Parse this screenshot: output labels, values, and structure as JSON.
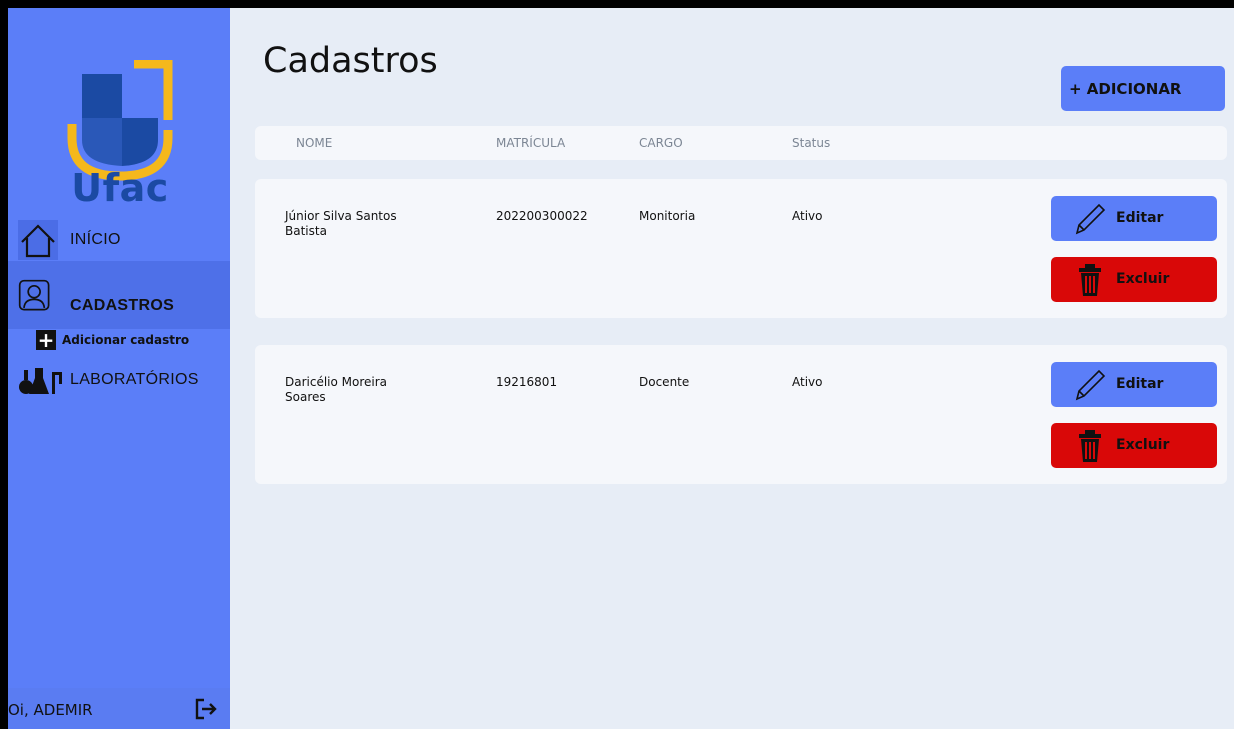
{
  "brand": {
    "name": "Ufac"
  },
  "sidebar": {
    "items": [
      {
        "label": "INÍCIO",
        "icon": "home-icon"
      },
      {
        "label": "CADASTROS",
        "icon": "user-icon",
        "active": true
      },
      {
        "label": "LABORATÓRIOS",
        "icon": "lab-icon"
      }
    ],
    "subitem": {
      "label": "Adicionar cadastro",
      "icon": "plus-icon"
    },
    "user": {
      "greeting": "Oi, ADEMIR",
      "icon": "logout-icon"
    }
  },
  "page": {
    "title": "Cadastros",
    "add_button": "+ ADICIONAR"
  },
  "table": {
    "headers": [
      "NOME",
      "MATRÍCULA",
      "CARGO",
      "Status"
    ],
    "rows": [
      {
        "name": "Júnior Silva Santos Batista",
        "matricula": "202200300022",
        "cargo": "Monitoria",
        "status": "Ativo",
        "edit": "Editar",
        "delete": "Excluir"
      },
      {
        "name": "Daricélio Moreira Soares",
        "matricula": "19216801",
        "cargo": "Docente",
        "status": "Ativo",
        "edit": "Editar",
        "delete": "Excluir"
      }
    ]
  },
  "colors": {
    "sidebar": "#5b7ef8",
    "primary_button": "#5b7ef8",
    "danger_button": "#d90808",
    "logo_dark": "#1b4aa3",
    "logo_accent": "#f5b81c"
  }
}
